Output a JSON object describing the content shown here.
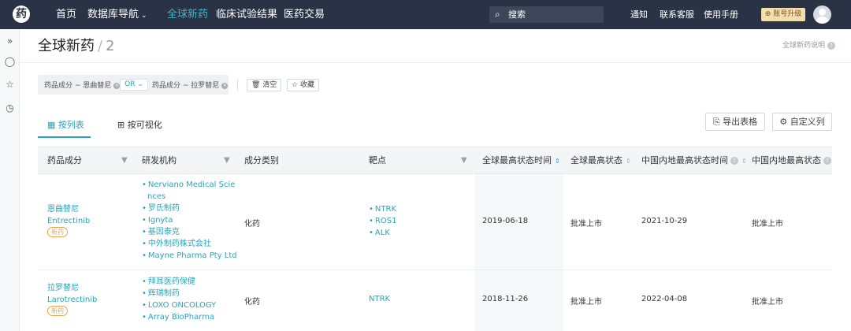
{
  "nav": {
    "logo": "药",
    "items": [
      {
        "label": "首页",
        "active": false
      },
      {
        "label": "数据库导航",
        "active": false,
        "dropdown": true
      },
      {
        "label": "全球新药",
        "active": true
      },
      {
        "label": "临床试验结果",
        "active": false
      },
      {
        "label": "医药交易",
        "active": false
      }
    ],
    "search_label": "搜索",
    "links": [
      "通知",
      "联系客服",
      "使用手册"
    ],
    "upgrade_label": "账号升级"
  },
  "rail": [
    "»",
    "◯",
    "☆",
    "◷"
  ],
  "page": {
    "title": "全球新药",
    "separator": "/",
    "count": "2",
    "help": "全球新药说明"
  },
  "filters": {
    "chip1": "药品成分 ~ 恩曲替尼",
    "operator": "OR",
    "chip2": "药品成分 ~ 拉罗替尼",
    "clear_label": "清空",
    "collect_label": "收藏"
  },
  "tabs": {
    "list": "按列表",
    "visual": "按可视化"
  },
  "actions": {
    "export": "导出表格",
    "custom_cols": "自定义列"
  },
  "table": {
    "columns": [
      "药品成分",
      "研发机构",
      "成分类别",
      "靶点",
      "全球最高状态时间",
      "全球最高状态",
      "中国内地最高状态时间",
      "中国内地最高状态"
    ],
    "rows": [
      {
        "drug_cn": "恩曲替尼",
        "drug_en": "Entrectinib",
        "badge": "新药",
        "orgs": [
          "Nerviano Medical Scie",
          "nces",
          "罗氏制药",
          "Ignyta",
          "基因泰克",
          "中外制药株式会社",
          "Mayne Pharma Pty Ltd"
        ],
        "category": "化药",
        "targets": [
          "NTRK",
          "ROS1",
          "ALK"
        ],
        "global_time": "2019-06-18",
        "global_status": "批准上市",
        "cn_time": "2021-10-29",
        "cn_status": "批准上市"
      },
      {
        "drug_cn": "拉罗替尼",
        "drug_en": "Larotrectinib",
        "badge": "新药",
        "orgs": [
          "拜耳医药保健",
          "辉瑞制药",
          "LOXO ONCOLOGY",
          "Array BioPharma"
        ],
        "category": "化药",
        "targets": [
          "NTRK"
        ],
        "global_time": "2018-11-26",
        "global_status": "批准上市",
        "cn_time": "2022-04-08",
        "cn_status": "批准上市"
      }
    ]
  }
}
